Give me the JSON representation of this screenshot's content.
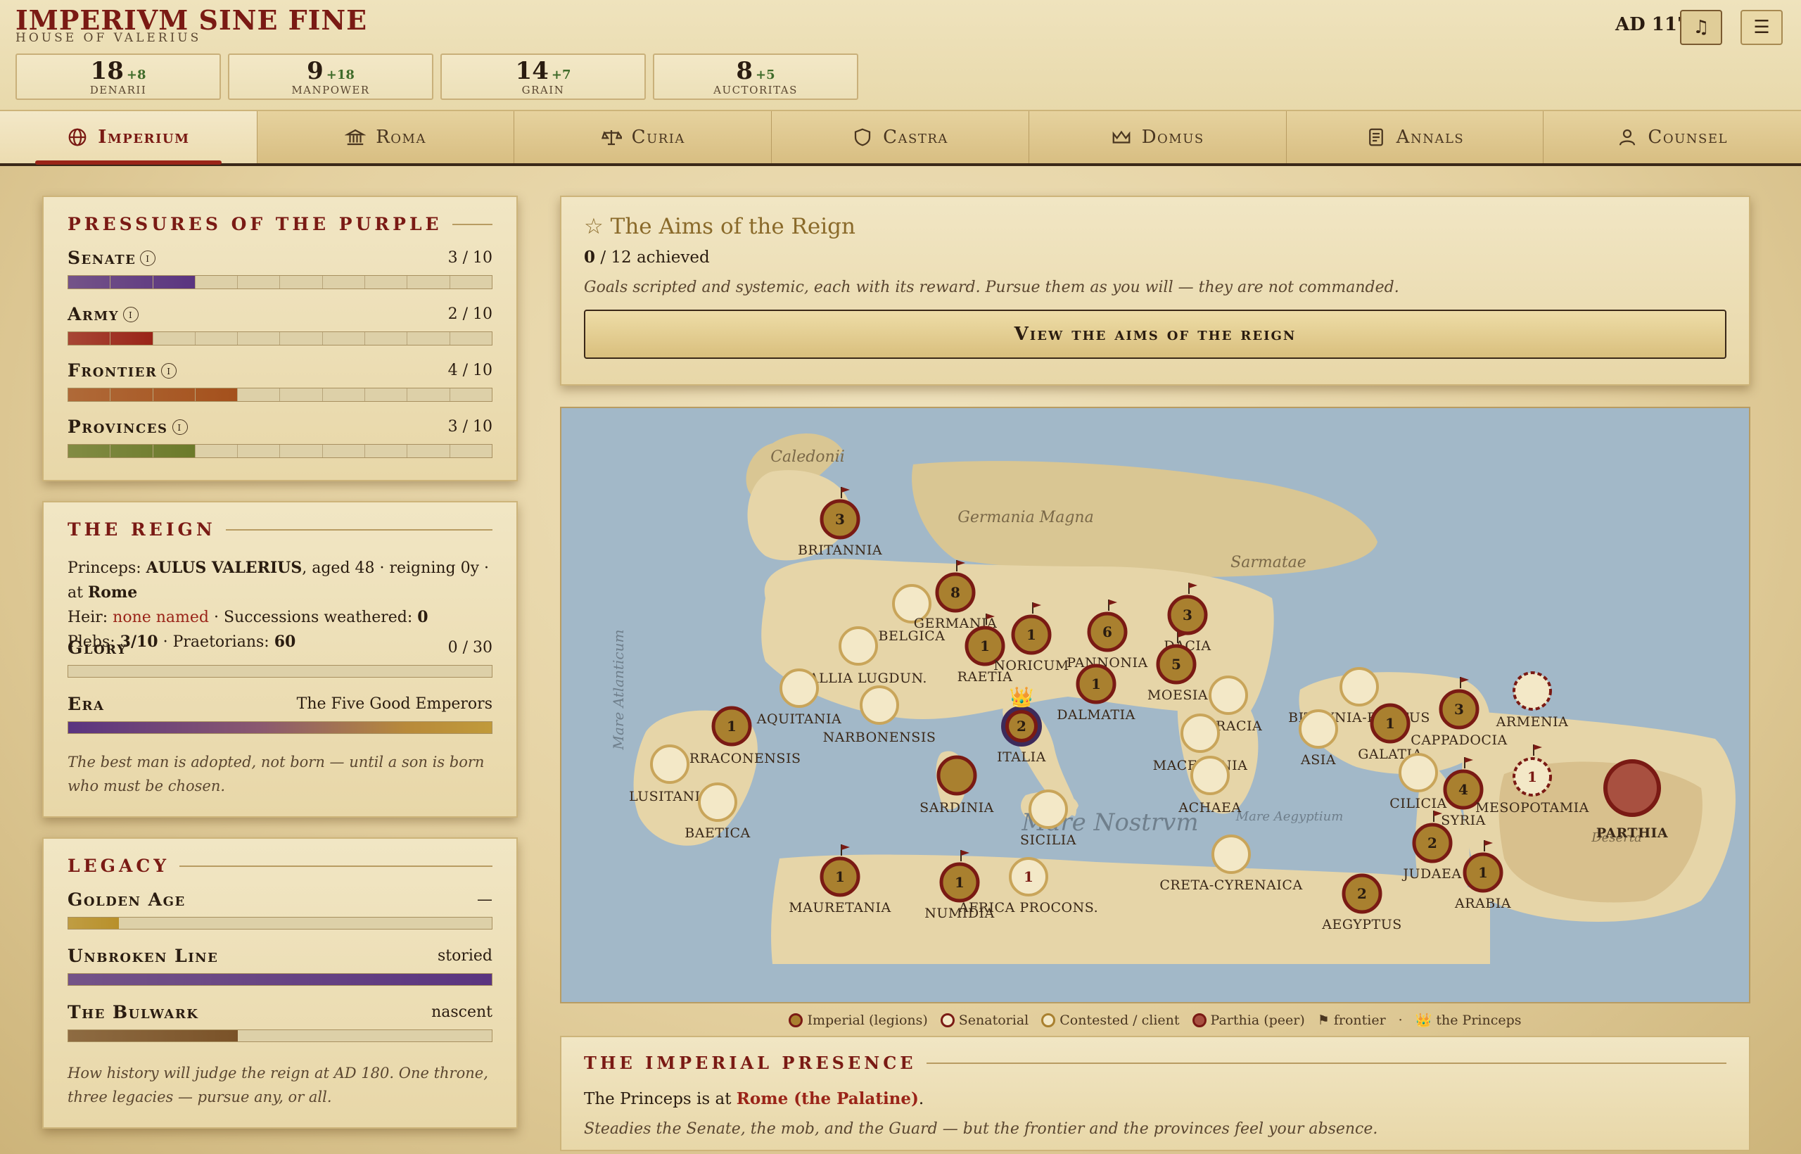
{
  "header": {
    "title": "IMPERIVM SINE FINE",
    "subtitle": "HOUSE OF VALERIUS",
    "year": "AD 117",
    "music_glyph": "♫",
    "menu_glyph": "☰"
  },
  "resources": [
    {
      "value": "18",
      "delta": "+8",
      "label": "DENARII"
    },
    {
      "value": "9",
      "delta": "+18",
      "label": "MANPOWER"
    },
    {
      "value": "14",
      "delta": "+7",
      "label": "GRAIN"
    },
    {
      "value": "8",
      "delta": "+5",
      "label": "AUCTORITAS"
    }
  ],
  "tabs": [
    {
      "label": "Imperium",
      "icon": "globe-icon",
      "active": true
    },
    {
      "label": "Roma",
      "icon": "temple-icon",
      "active": false
    },
    {
      "label": "Curia",
      "icon": "scales-icon",
      "active": false
    },
    {
      "label": "Castra",
      "icon": "shield-icon",
      "active": false
    },
    {
      "label": "Domus",
      "icon": "crown-icon",
      "active": false
    },
    {
      "label": "Annals",
      "icon": "scroll-icon",
      "active": false
    },
    {
      "label": "Counsel",
      "icon": "person-icon",
      "active": false
    }
  ],
  "pressures": {
    "heading": "PRESSURES OF THE PURPLE",
    "items": [
      {
        "name": "Senate",
        "value": "3 / 10",
        "fraction": 0.3,
        "color": "#5a3480"
      },
      {
        "name": "Army",
        "value": "2 / 10",
        "fraction": 0.2,
        "color": "#9a2418"
      },
      {
        "name": "Frontier",
        "value": "4 / 10",
        "fraction": 0.4,
        "color": "#a4501c"
      },
      {
        "name": "Provinces",
        "value": "3 / 10",
        "fraction": 0.3,
        "color": "#6b7a2a"
      }
    ]
  },
  "reign": {
    "heading": "THE REIGN",
    "princeps_label": "Princeps:",
    "princeps_name": "AULUS VALERIUS",
    "princeps_detail": ", aged 48 · reigning 0y · at",
    "princeps_place": "Rome",
    "heir_label": "Heir:",
    "heir_value": "none named",
    "successions_label": "· Successions weathered:",
    "successions_value": "0",
    "plebs_label": "Plebs:",
    "plebs_value": "3/10",
    "praetorians_label": "· Praetorians:",
    "praetorians_value": "60",
    "glory_label": "Glory",
    "glory_value": "0 / 30",
    "glory_fraction": 0.0,
    "era_label": "Era",
    "era_value": "The Five Good Emperors",
    "note": "The best man is adopted, not born — until a son is born who must be chosen."
  },
  "legacy": {
    "heading": "LEGACY",
    "items": [
      {
        "name": "Golden Age",
        "value": "—",
        "fraction": 0.12,
        "color": "#b8902a"
      },
      {
        "name": "Unbroken Line",
        "value": "storied",
        "fraction": 1.0,
        "color": "#5a3480"
      },
      {
        "name": "The Bulwark",
        "value": "nascent",
        "fraction": 0.4,
        "color": "#7a5228"
      }
    ],
    "note": "How history will judge the reign at AD 180. One throne, three legacies — pursue any, or all."
  },
  "aims": {
    "title": "☆ The Aims of the Reign",
    "achieved_count": "0",
    "achieved_text": "/ 12 achieved",
    "description": "Goals scripted and systemic, each with its reward. Pursue them as you will — they are not commanded.",
    "button": "View the aims of the reign"
  },
  "map": {
    "sea_labels": [
      "Mare Nostrvm",
      "Mare Atlanticum",
      "Mare Aegyptium"
    ],
    "land_labels": [
      "Caledonii",
      "Germania Magna",
      "Sarmatae",
      "Deserta"
    ],
    "provinces": [
      {
        "label": "BRITANNIA",
        "type": "imperial",
        "legions": "3",
        "frontier": true
      },
      {
        "label": "BELGICA",
        "type": "senatorial",
        "legions": "",
        "frontier": false
      },
      {
        "label": "GERMANIA",
        "type": "imperial",
        "legions": "8",
        "frontier": true
      },
      {
        "label": "GALLIA LUGDUN.",
        "type": "senatorial",
        "legions": "",
        "frontier": false
      },
      {
        "label": "AQUITANIA",
        "type": "senatorial",
        "legions": "",
        "frontier": false
      },
      {
        "label": "NARBONENSIS",
        "type": "senatorial",
        "legions": "",
        "frontier": false
      },
      {
        "label": "RAETIA",
        "type": "imperial",
        "legions": "1",
        "frontier": true
      },
      {
        "label": "NORICUM",
        "type": "imperial",
        "legions": "1",
        "frontier": true
      },
      {
        "label": "PANNONIA",
        "type": "imperial",
        "legions": "6",
        "frontier": true
      },
      {
        "label": "DACIA",
        "type": "imperial",
        "legions": "3",
        "frontier": true
      },
      {
        "label": "MOESIA",
        "type": "imperial",
        "legions": "5",
        "frontier": true
      },
      {
        "label": "DALMATIA",
        "type": "imperial",
        "legions": "1",
        "frontier": false
      },
      {
        "label": "ITALIA",
        "type": "princeps",
        "legions": "2",
        "frontier": false
      },
      {
        "label": "TARRACONENSIS",
        "type": "imperial",
        "legions": "1",
        "frontier": false
      },
      {
        "label": "LUSITANIA",
        "type": "senatorial",
        "legions": "",
        "frontier": false
      },
      {
        "label": "BAETICA",
        "type": "senatorial",
        "legions": "",
        "frontier": false
      },
      {
        "label": "SARDINIA",
        "type": "imperial",
        "legions": "",
        "frontier": false
      },
      {
        "label": "SICILIA",
        "type": "senatorial",
        "legions": "",
        "frontier": false
      },
      {
        "label": "THRACIA",
        "type": "senatorial",
        "legions": "",
        "frontier": false
      },
      {
        "label": "MACEDONIA",
        "type": "senatorial",
        "legions": "",
        "frontier": false
      },
      {
        "label": "ACHAEA",
        "type": "senatorial",
        "legions": "",
        "frontier": false
      },
      {
        "label": "BITHYNIA-PONTUS",
        "type": "senatorial",
        "legions": "",
        "frontier": false
      },
      {
        "label": "ASIA",
        "type": "senatorial",
        "legions": "",
        "frontier": false
      },
      {
        "label": "GALATIA",
        "type": "imperial",
        "legions": "1",
        "frontier": false
      },
      {
        "label": "CAPPADOCIA",
        "type": "imperial",
        "legions": "3",
        "frontier": true
      },
      {
        "label": "ARMENIA",
        "type": "contested",
        "legions": "",
        "frontier": false
      },
      {
        "label": "CILICIA",
        "type": "senatorial",
        "legions": "",
        "frontier": false
      },
      {
        "label": "SYRIA",
        "type": "imperial",
        "legions": "4",
        "frontier": true
      },
      {
        "label": "MESOPOTAMIA",
        "type": "contested",
        "legions": "1",
        "frontier": true
      },
      {
        "label": "PARTHIA",
        "type": "parthia",
        "legions": "",
        "frontier": false
      },
      {
        "label": "JUDAEA",
        "type": "imperial",
        "legions": "2",
        "frontier": true
      },
      {
        "label": "ARABIA",
        "type": "imperial",
        "legions": "1",
        "frontier": true
      },
      {
        "label": "AEGYPTUS",
        "type": "imperial",
        "legions": "2",
        "frontier": false
      },
      {
        "label": "CRETA-CYRENAICA",
        "type": "senatorial",
        "legions": "",
        "frontier": false
      },
      {
        "label": "AFRICA PROCONS.",
        "type": "senatorial",
        "legions": "1",
        "frontier": false
      },
      {
        "label": "NUMIDIA",
        "type": "imperial",
        "legions": "1",
        "frontier": true
      },
      {
        "label": "MAURETANIA",
        "type": "imperial",
        "legions": "1",
        "frontier": true
      }
    ]
  },
  "legend": {
    "imperial": "Imperial (legions)",
    "senatorial": "Senatorial",
    "contested": "Contested / client",
    "parthia": "Parthia (peer)",
    "frontier": "⚑ frontier",
    "sep": "·",
    "princeps": "👑 the Princeps"
  },
  "presence": {
    "heading": "THE IMPERIAL PRESENCE",
    "text_before": "The Princeps is at",
    "location": "Rome (the Palatine)",
    "text_after": ".",
    "note": "Steadies the Senate, the mob, and the Guard — but the frontier and the provinces feel your absence."
  }
}
